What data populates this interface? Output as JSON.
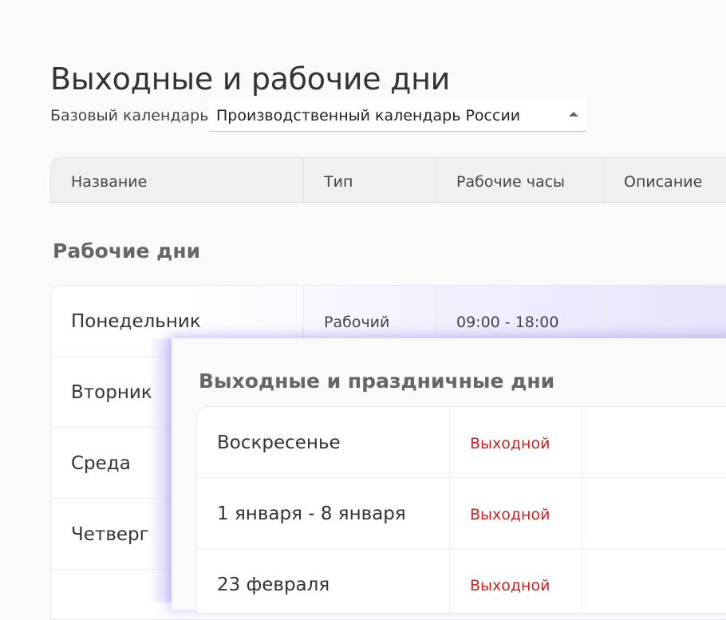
{
  "page": {
    "title": "Выходные и рабочие дни"
  },
  "calendar": {
    "label": "Базовый календарь",
    "selected": "Производственный календарь России"
  },
  "columns": [
    "Название",
    "Тип",
    "Рабочие часы",
    "Описание"
  ],
  "work_days": {
    "title": "Рабочие дни",
    "rows": [
      {
        "name": "Понедельник",
        "type": "Рабочий",
        "hours": "09:00 - 18:00"
      },
      {
        "name": "Вторник"
      },
      {
        "name": "Среда"
      },
      {
        "name": "Четверг"
      }
    ]
  },
  "holidays": {
    "title": "Выходные и праздничные дни",
    "rows": [
      {
        "name": "Воскресенье",
        "type": "Выходной"
      },
      {
        "name": "1 января - 8 января",
        "type": "Выходной"
      },
      {
        "name": "23 февраля",
        "type": "Выходной"
      }
    ]
  },
  "colors": {
    "holiday_type": "#d81e1e",
    "highlight": "#e6e3fb"
  }
}
